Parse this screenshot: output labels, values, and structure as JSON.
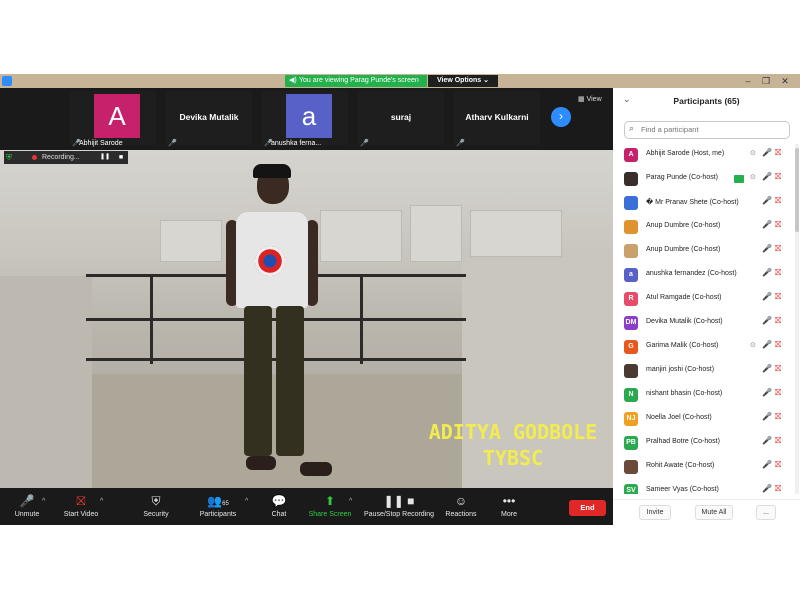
{
  "window": {
    "share_banner": "You are viewing Parag Punde's screen",
    "view_options": "View Options",
    "minimize": "–",
    "maximize": "❐",
    "close": "✕"
  },
  "strip": {
    "tiles": [
      {
        "avatar": "A",
        "name": "",
        "label": "Abhijit Sarode",
        "color": "#c5226b"
      },
      {
        "avatar": "",
        "name": "Devika Mutalik",
        "label": "",
        "color": ""
      },
      {
        "avatar": "a",
        "name": "",
        "label": "anushka ferna...",
        "color": "#5861c8"
      },
      {
        "avatar": "",
        "name": "suraj",
        "label": "",
        "color": ""
      },
      {
        "avatar": "",
        "name": "Atharv Kulkarni",
        "label": "",
        "color": ""
      }
    ],
    "next_icon": "›",
    "view_label": "View"
  },
  "video": {
    "caption_name": "ADITYA GODBOLE",
    "caption_course": "TYBSC",
    "recording_label": "Recording..."
  },
  "toolbar": {
    "unmute": "Unmute",
    "start_video": "Start Video",
    "security": "Security",
    "participants": "Participants",
    "participants_count": "65",
    "chat": "Chat",
    "share_screen": "Share Screen",
    "pause_stop": "Pause/Stop Recording",
    "reactions": "Reactions",
    "more": "More",
    "end": "End"
  },
  "panel": {
    "title": "Participants (65)",
    "search_placeholder": "Find a participant",
    "participants": [
      {
        "initials": "A",
        "name": "Abhijit Sarode (Host, me)",
        "color": "#c5226b",
        "rec": true,
        "badge": false
      },
      {
        "initials": "",
        "name": "Parag Punde (Co-host)",
        "color": "#3b2e2a",
        "rec": true,
        "badge": true
      },
      {
        "initials": "",
        "name": "� Mr Pranav Shete (Co-host)",
        "color": "#3a6fd8",
        "rec": false,
        "badge": false
      },
      {
        "initials": "",
        "name": "Anup Dumbre (Co-host)",
        "color": "#e0922f",
        "rec": false,
        "badge": false
      },
      {
        "initials": "",
        "name": "Anup Dumbre (Co-host)",
        "color": "#c8a26a",
        "rec": false,
        "badge": false
      },
      {
        "initials": "a",
        "name": "anushka fernandez (Co-host)",
        "color": "#5861c8",
        "rec": false,
        "badge": false
      },
      {
        "initials": "R",
        "name": "Atul Ramgade (Co-host)",
        "color": "#e64b6a",
        "rec": false,
        "badge": false
      },
      {
        "initials": "DM",
        "name": "Devika Mutalik (Co-host)",
        "color": "#8b3fc9",
        "rec": false,
        "badge": false
      },
      {
        "initials": "G",
        "name": "Garima Malik (Co-host)",
        "color": "#e8571c",
        "rec": true,
        "badge": false
      },
      {
        "initials": "",
        "name": "manjiri joshi (Co-host)",
        "color": "#4a3a32",
        "rec": false,
        "badge": false
      },
      {
        "initials": "N",
        "name": "nishant bhasin (Co-host)",
        "color": "#2aa94e",
        "rec": false,
        "badge": false
      },
      {
        "initials": "NJ",
        "name": "Noella Joel (Co-host)",
        "color": "#f0a01e",
        "rec": false,
        "badge": false
      },
      {
        "initials": "PB",
        "name": "Pralhad Botre (Co-host)",
        "color": "#2aa94e",
        "rec": false,
        "badge": false
      },
      {
        "initials": "",
        "name": "Rohit Awate (Co-host)",
        "color": "#6b4a3a",
        "rec": false,
        "badge": false
      },
      {
        "initials": "SV",
        "name": "Sameer Vyas (Co-host)",
        "color": "#2aa94e",
        "rec": false,
        "badge": false
      }
    ],
    "invite": "Invite",
    "mute_all": "Mute All",
    "more": "..."
  }
}
